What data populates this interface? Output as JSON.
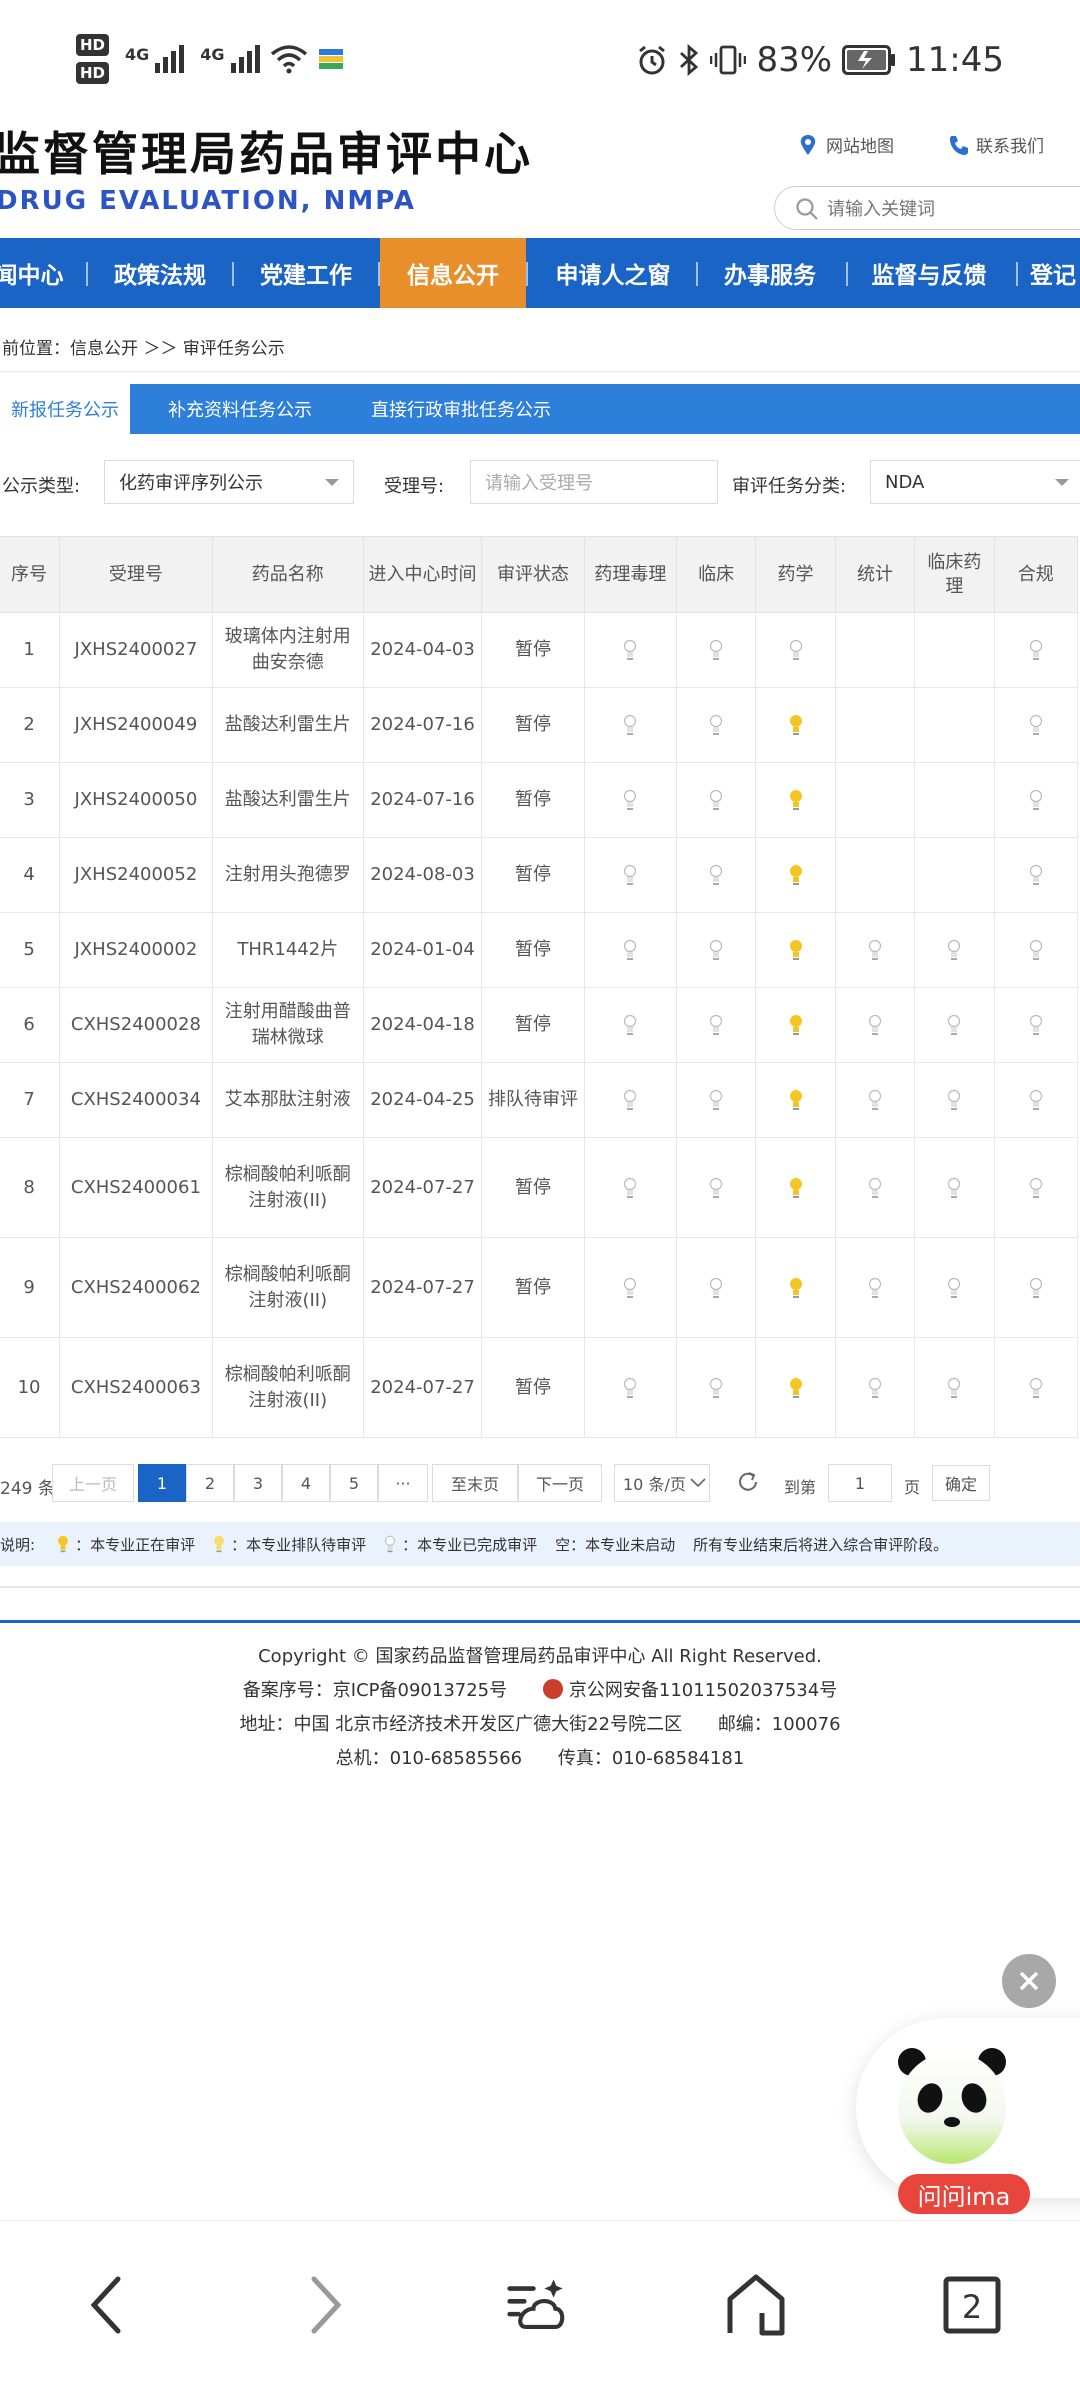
{
  "status_bar": {
    "hd1": "HD",
    "hd2": "HD",
    "net1": "4G",
    "net2": "4G",
    "battery_percent": "83%",
    "time": "11:45"
  },
  "header": {
    "title": "监督管理局药品审评中心",
    "subtitle": "DRUG EVALUATION, NMPA",
    "sitemap_label": "网站地图",
    "contact_label": "联系我们",
    "search_placeholder": "请输入关键词"
  },
  "nav": {
    "items": [
      "闻中心",
      "政策法规",
      "党建工作",
      "信息公开",
      "申请人之窗",
      "办事服务",
      "监督与反馈",
      "登记"
    ],
    "active_index": 3
  },
  "breadcrumb": "前位置：信息公开 ＞＞ 审评任务公示",
  "tabs": [
    "新报任务公示",
    "补充资料任务公示",
    "直接行政审批任务公示"
  ],
  "filters": {
    "type_label": "公示类型:",
    "type_value": "化药审评序列公示",
    "accept_label": "受理号:",
    "accept_placeholder": "请输入受理号",
    "category_label": "审评任务分类:",
    "category_value": "NDA"
  },
  "table": {
    "headers": [
      "序号",
      "受理号",
      "药品名称",
      "进入中心时间",
      "审评状态",
      "药理毒理",
      "临床",
      "药学",
      "统计",
      "临床药理",
      "合规"
    ],
    "rows": [
      {
        "no": "1",
        "id": "JXHS2400027",
        "name": "玻璃体内注射用曲安奈德",
        "date": "2024-04-03",
        "status": "暂停",
        "c": [
          "done",
          "done",
          "done",
          "",
          "",
          "done"
        ]
      },
      {
        "no": "2",
        "id": "JXHS2400049",
        "name": "盐酸达利雷生片",
        "date": "2024-07-16",
        "status": "暂停",
        "c": [
          "done",
          "done",
          "queue",
          "",
          "",
          "done"
        ]
      },
      {
        "no": "3",
        "id": "JXHS2400050",
        "name": "盐酸达利雷生片",
        "date": "2024-07-16",
        "status": "暂停",
        "c": [
          "done",
          "done",
          "queue",
          "",
          "",
          "done"
        ]
      },
      {
        "no": "4",
        "id": "JXHS2400052",
        "name": "注射用头孢德罗",
        "date": "2024-08-03",
        "status": "暂停",
        "c": [
          "done",
          "done",
          "queue",
          "",
          "",
          "done"
        ]
      },
      {
        "no": "5",
        "id": "JXHS2400002",
        "name": "THR1442片",
        "date": "2024-01-04",
        "status": "暂停",
        "c": [
          "done",
          "done",
          "queue",
          "done",
          "done",
          "done"
        ]
      },
      {
        "no": "6",
        "id": "CXHS2400028",
        "name": "注射用醋酸曲普瑞林微球",
        "date": "2024-04-18",
        "status": "暂停",
        "c": [
          "done",
          "done",
          "queue",
          "done",
          "done",
          "done"
        ]
      },
      {
        "no": "7",
        "id": "CXHS2400034",
        "name": "艾本那肽注射液",
        "date": "2024-04-25",
        "status": "排队待审评",
        "c": [
          "done",
          "done",
          "queue",
          "done",
          "done",
          "done"
        ]
      },
      {
        "no": "8",
        "id": "CXHS2400061",
        "name": "棕榈酸帕利哌酮注射液(II)",
        "date": "2024-07-27",
        "status": "暂停",
        "c": [
          "done",
          "done",
          "queue",
          "done",
          "done",
          "done"
        ]
      },
      {
        "no": "9",
        "id": "CXHS2400062",
        "name": "棕榈酸帕利哌酮注射液(II)",
        "date": "2024-07-27",
        "status": "暂停",
        "c": [
          "done",
          "done",
          "queue",
          "done",
          "done",
          "done"
        ]
      },
      {
        "no": "10",
        "id": "CXHS2400063",
        "name": "棕榈酸帕利哌酮注射液(II)",
        "date": "2024-07-27",
        "status": "暂停",
        "c": [
          "done",
          "done",
          "queue",
          "done",
          "done",
          "done"
        ]
      }
    ]
  },
  "pager": {
    "total": "249 条",
    "prev": "上一页",
    "pages": [
      "1",
      "2",
      "3",
      "4",
      "5",
      "···"
    ],
    "current": "1",
    "last": "至末页",
    "next": "下一页",
    "page_size": "10 条/页",
    "goto_label": "到第",
    "goto_value": "1",
    "page_unit": "页",
    "confirm": "确定"
  },
  "legend": {
    "prefix": "说明:",
    "in_review": "：本专业正在审评",
    "queued": "：本专业排队待审评",
    "done": "：本专业已完成审评",
    "empty": "空：本专业未启动",
    "note": "所有专业结束后将进入综合审评阶段。"
  },
  "footer": {
    "copyright": "Copyright © 国家药品监督管理局药品审评中心  All Right Reserved.",
    "icp": "备案序号：京ICP备09013725号",
    "police": "京公网安备11011502037534号",
    "address": "地址：中国 北京市经济技术开发区广德大街22号院二区",
    "postcode": "邮编：100076",
    "phone": "总机：010-68585566",
    "fax": "传真：010-68584181"
  },
  "assistant": {
    "label": "问问ima"
  },
  "bottom_nav": {
    "tab_count": "2"
  },
  "colors": {
    "nav_blue": "#1a64c6",
    "nav_active": "#e88f2b",
    "tab_blue": "#2d7fd9",
    "bulb_active": "#f3c623",
    "bulb_done": "#cfcfcf"
  }
}
